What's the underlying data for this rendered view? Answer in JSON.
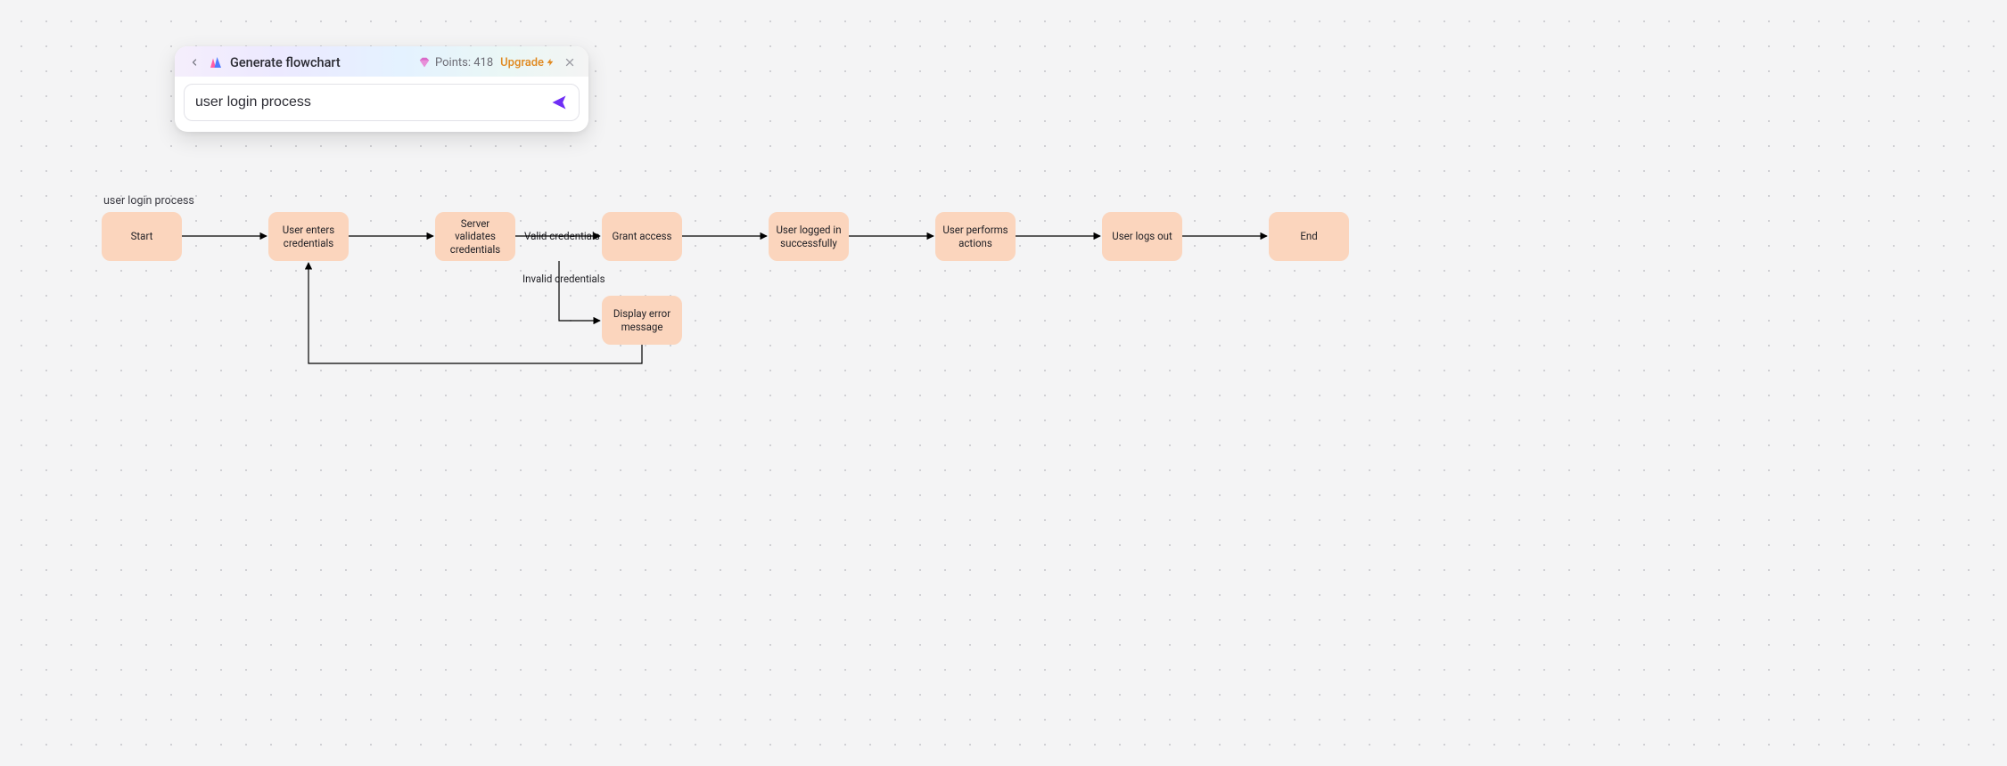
{
  "panel": {
    "title": "Generate flowchart",
    "points_label": "Points:",
    "points_value": "418",
    "upgrade_label": "Upgrade",
    "input_value": "user login process",
    "input_placeholder": ""
  },
  "diagram": {
    "title": "user login process",
    "nodes": [
      {
        "id": "start",
        "label": "Start"
      },
      {
        "id": "enter",
        "label": "User enters credentials"
      },
      {
        "id": "validate",
        "label": "Server validates credentials"
      },
      {
        "id": "grant",
        "label": "Grant access"
      },
      {
        "id": "loggedin",
        "label": "User logged in successfully"
      },
      {
        "id": "actions",
        "label": "User performs actions"
      },
      {
        "id": "logout",
        "label": "User logs out"
      },
      {
        "id": "end",
        "label": "End"
      },
      {
        "id": "error",
        "label": "Display error message"
      }
    ],
    "edge_labels": {
      "valid": "Valid credentials",
      "invalid": "Invalid credentials"
    }
  },
  "colors": {
    "node_fill": "#fbd5bd",
    "accent": "#6f2ef5",
    "upgrade": "#e0881e"
  }
}
